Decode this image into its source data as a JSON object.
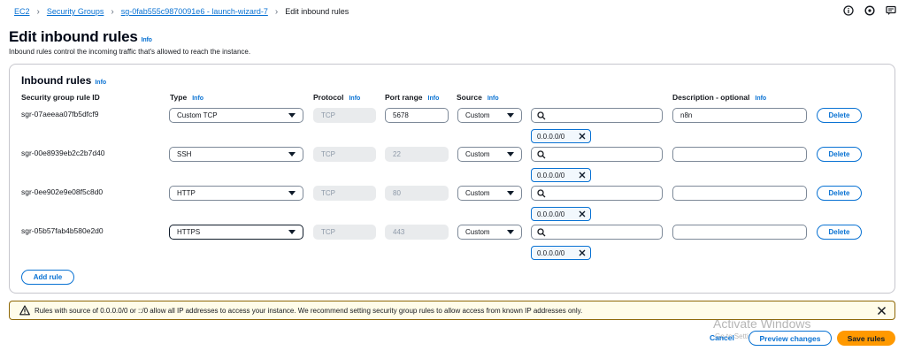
{
  "breadcrumb": {
    "items": [
      "EC2",
      "Security Groups",
      "sg-0fab555c9870091e6 - launch-wizard-7"
    ],
    "current": "Edit inbound rules"
  },
  "page": {
    "title": "Edit inbound rules",
    "info": "Info",
    "description": "Inbound rules control the incoming traffic that's allowed to reach the instance."
  },
  "panel": {
    "title": "Inbound rules",
    "info": "Info",
    "columns": {
      "rule_id": "Security group rule ID",
      "type": "Type",
      "protocol": "Protocol",
      "port_range": "Port range",
      "source": "Source",
      "description": "Description - optional",
      "info": "Info"
    }
  },
  "rules": [
    {
      "id": "sgr-07aeeaa07fb5dfcf9",
      "type": "Custom TCP",
      "protocol": "TCP",
      "port": "5678",
      "source": "Custom",
      "token": "0.0.0.0/0",
      "description": "n8n",
      "delete": "Delete"
    },
    {
      "id": "sgr-00e8939eb2c2b7d40",
      "type": "SSH",
      "protocol": "TCP",
      "port": "22",
      "source": "Custom",
      "token": "0.0.0.0/0",
      "description": "",
      "delete": "Delete"
    },
    {
      "id": "sgr-0ee902e9e08f5c8d0",
      "type": "HTTP",
      "protocol": "TCP",
      "port": "80",
      "source": "Custom",
      "token": "0.0.0.0/0",
      "description": "",
      "delete": "Delete"
    },
    {
      "id": "sgr-05b57fab4b580e2d0",
      "type": "HTTPS",
      "protocol": "TCP",
      "port": "443",
      "source": "Custom",
      "token": "0.0.0.0/0",
      "description": "",
      "delete": "Delete"
    }
  ],
  "add_rule": "Add rule",
  "alert": {
    "text": "Rules with source of 0.0.0.0/0 or ::/0 allow all IP addresses to access your instance. We recommend setting security group rules to allow access from known IP addresses only."
  },
  "footer": {
    "cancel": "Cancel",
    "preview": "Preview changes",
    "save": "Save rules"
  },
  "watermark": {
    "title": "Activate Windows",
    "subtitle": "Go to Settings to activate Windows."
  },
  "colors": {
    "link": "#0972d3",
    "primary": "#ff9900",
    "warning_border": "#8d6605",
    "warning_bg": "#fffce9"
  }
}
